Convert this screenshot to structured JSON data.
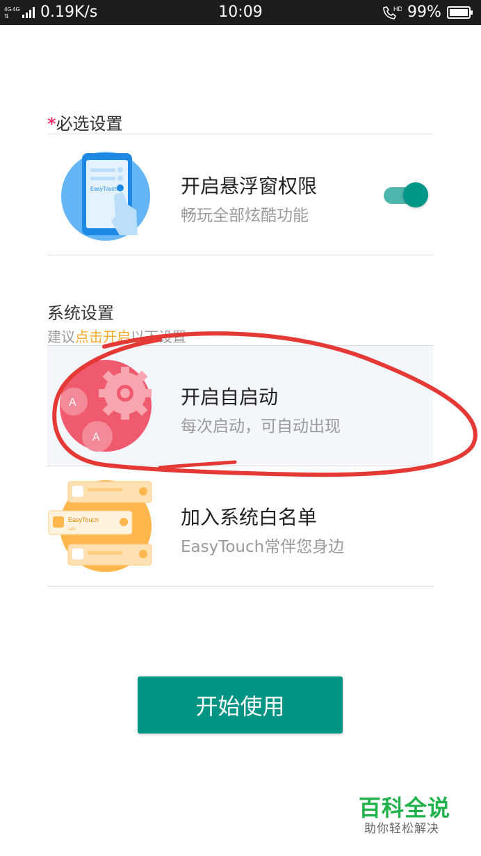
{
  "status_bar": {
    "network": "4G 4G",
    "speed": "0.19K/s",
    "time": "10:09",
    "call_badge": "HD",
    "battery": "99%"
  },
  "required_section": {
    "star": "*",
    "title": "必选设置",
    "items": [
      {
        "title": "开启悬浮窗权限",
        "subtitle": "畅玩全部炫酷功能",
        "icon": "phone-floating-window-icon",
        "toggle_on": true
      }
    ]
  },
  "system_section": {
    "title": "系统设置",
    "hint_before": "建议",
    "hint_highlight": "点击开启",
    "hint_after": "以下设置",
    "items": [
      {
        "title": "开启自启动",
        "subtitle": "每次启动，可自动出现",
        "icon": "gears-icon",
        "icon_letter": "A"
      },
      {
        "title": "加入系统白名单",
        "subtitle": "EasyTouch常伴您身边",
        "icon": "whitelist-cards-icon",
        "card_label": "EasyTouch",
        "card_sub": "safe"
      }
    ]
  },
  "illustration_text": "EasyTouch",
  "start_button": "开始使用",
  "watermark": {
    "main": "百科全说",
    "sub": "助你轻松解决"
  },
  "colors": {
    "accent": "#009485",
    "toggle": "#009688",
    "star": "#e8336d",
    "highlight": "#ffa726",
    "annotation": "#e53935"
  }
}
